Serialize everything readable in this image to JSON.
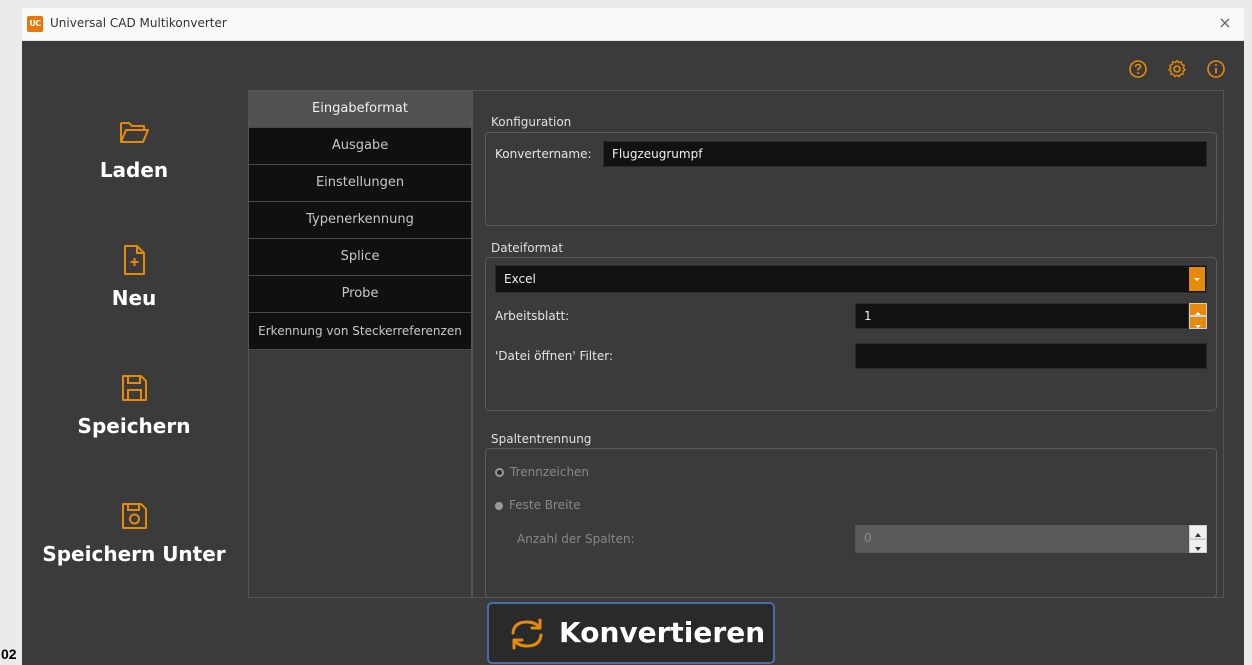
{
  "window": {
    "app_icon_text": "UC",
    "title": "Universal CAD Multikonverter",
    "close_glyph": "×"
  },
  "top_icons": [
    "help-circle-icon",
    "settings-gear-icon",
    "info-icon"
  ],
  "sidebar": {
    "items": [
      {
        "label": "Laden",
        "icon": "folder-open-icon"
      },
      {
        "label": "Neu",
        "icon": "new-file-icon"
      },
      {
        "label": "Speichern",
        "icon": "save-icon"
      },
      {
        "label": "Speichern Unter",
        "icon": "save-as-icon"
      }
    ]
  },
  "tabs": [
    {
      "label": "Eingabeformat",
      "active": true
    },
    {
      "label": "Ausgabe"
    },
    {
      "label": "Einstellungen"
    },
    {
      "label": "Typenerkennung"
    },
    {
      "label": "Splice"
    },
    {
      "label": "Probe"
    },
    {
      "label": "Erkennung von Steckerreferenzen"
    }
  ],
  "konfiguration": {
    "title": "Konfiguration",
    "name_label": "Konvertername:",
    "name_value": "Flugzeugrumpf"
  },
  "dateiformat": {
    "title": "Dateiformat",
    "format_value": "Excel",
    "sheet_label": "Arbeitsblatt:",
    "sheet_value": "1",
    "filter_label": "'Datei öffnen' Filter:",
    "filter_value": ""
  },
  "spaltentrennung": {
    "title": "Spaltentrennung",
    "option_delimiter": "Trennzeichen",
    "option_fixed": "Feste Breite",
    "columns_label": "Anzahl der Spalten:",
    "columns_value": "0"
  },
  "convert_button": {
    "label": "Konvertieren",
    "icon": "refresh-arrows-icon"
  },
  "page_number": "02",
  "colors": {
    "accent_orange": "#e58a0a",
    "background": "#3b3b3b",
    "field_bg": "#111111"
  }
}
